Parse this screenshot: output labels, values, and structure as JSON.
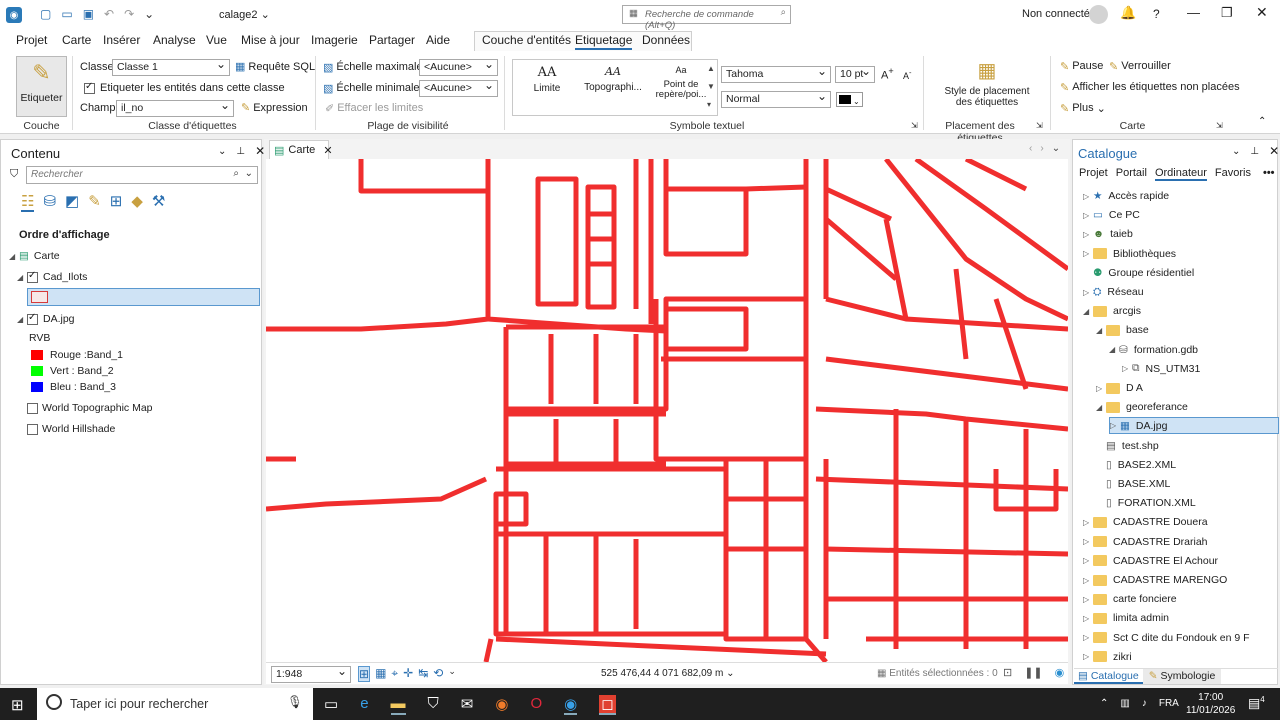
{
  "title": {
    "project": "calage2",
    "search_placeholder": "Recherche de commande (Alt+Q)",
    "user": "Non connecté",
    "help": "?"
  },
  "menu": {
    "items": [
      "Projet",
      "Carte",
      "Insérer",
      "Analyse",
      "Vue",
      "Mise à jour",
      "Imagerie",
      "Partager",
      "Aide"
    ],
    "context_tabs": [
      "Couche d'entités",
      "Etiquetage",
      "Données"
    ]
  },
  "ribbon": {
    "couche": {
      "button": "Etiqueter",
      "label": "Couche"
    },
    "classe": {
      "classe_label": "Classe",
      "classe_value": "Classe 1",
      "sql": "Requête SQL",
      "label_entities": "Etiqueter les entités dans cette classe",
      "champ_label": "Champ",
      "champ_value": "il_no",
      "expression": "Expression",
      "group": "Classe d'étiquettes"
    },
    "visibilite": {
      "max": "Échelle maximale",
      "max_value": "<Aucune>",
      "min": "Échelle minimale",
      "min_value": "<Aucune>",
      "clear": "Effacer les limites",
      "group": "Plage de visibilité"
    },
    "symbole": {
      "gallery": [
        {
          "glyph": "AA",
          "label": "Limite"
        },
        {
          "glyph": "AA",
          "label": "Topographi..."
        },
        {
          "glyph": "Aa",
          "label": "Point de repère/poi..."
        }
      ],
      "font": "Tahoma",
      "size": "10 pt",
      "style": "Normal",
      "group": "Symbole textuel"
    },
    "placement": {
      "label": "Style de placement des étiquettes",
      "group": "Placement des étiquettes"
    },
    "carte": {
      "pause": "Pause",
      "lock": "Verrouiller",
      "unplaced": "Afficher les étiquettes non placées",
      "more": "Plus",
      "group": "Carte"
    }
  },
  "contents": {
    "title": "Contenu",
    "search_placeholder": "Rechercher",
    "order": "Ordre d'affichage",
    "layers": {
      "map": "Carte",
      "cad": "Cad_Ilots",
      "da": "DA.jpg",
      "rvb": "RVB",
      "red": "Rouge :Band_1",
      "green": "Vert : Band_2",
      "blue": "Bleu : Band_3",
      "topo": "World Topographic Map",
      "hill": "World Hillshade"
    },
    "colors": {
      "red": "#ff0000",
      "green": "#00ff00",
      "blue": "#0000ff"
    }
  },
  "map": {
    "tab": "Carte",
    "scale": "1:948",
    "coords": "525 476,44 4 071 682,09 m",
    "selected": "Entités sélectionnées : 0"
  },
  "catalog": {
    "title": "Catalogue",
    "tabs": [
      "Projet",
      "Portail",
      "Ordinateur",
      "Favoris"
    ],
    "items": [
      "Accès rapide",
      "Ce PC",
      "taieb",
      "Bibliothèques",
      "Groupe résidentiel",
      "Réseau",
      "arcgis",
      "base",
      "formation.gdb",
      "NS_UTM31",
      "D A",
      "georeferance",
      "DA.jpg",
      "test.shp",
      "BASE2.XML",
      "BASE.XML",
      "FORATION.XML",
      "CADASTRE Douera",
      "CADASTRE Drariah",
      "CADASTRE El Achour",
      "CADASTRE MARENGO",
      "carte fonciere",
      "limita admin",
      "Sct C dite du Fondouk en 9 F",
      "zikri"
    ],
    "bottom_tabs": [
      "Catalogue",
      "Symbologie"
    ]
  },
  "taskbar": {
    "search": "Taper ici pour rechercher",
    "lang": "FRA",
    "time": "17:00",
    "date": "11/01/2026",
    "notif": "4"
  }
}
